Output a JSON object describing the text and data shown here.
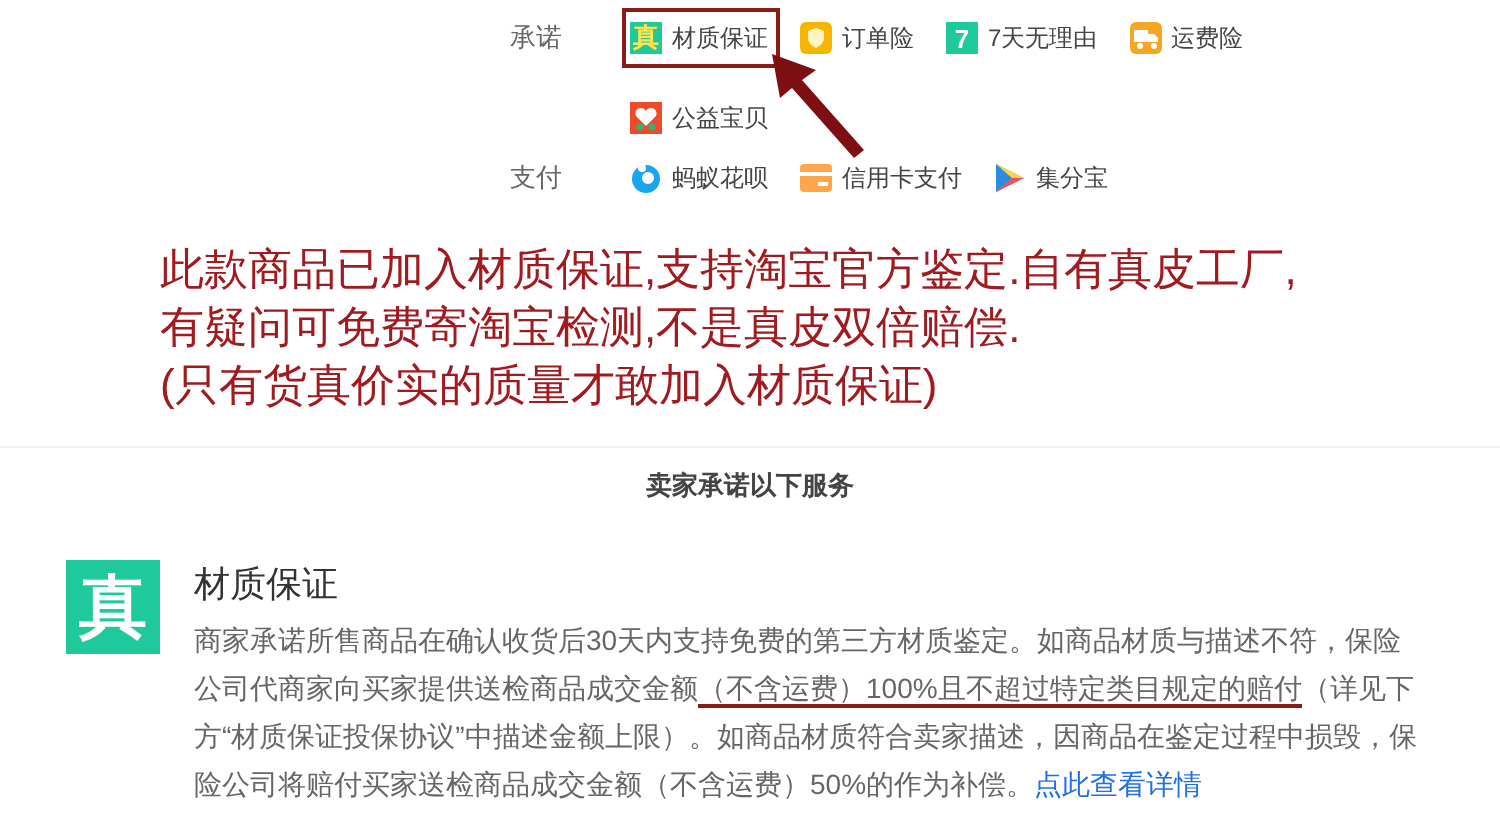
{
  "service_rows": [
    {
      "label": "承诺",
      "items": [
        {
          "kind": "zhen",
          "glyph": "真",
          "text": "材质保证",
          "selected": true
        },
        {
          "kind": "shield",
          "text": "订单险",
          "selected": false
        },
        {
          "kind": "seven",
          "glyph": "7",
          "text": "7天无理由",
          "selected": false
        },
        {
          "kind": "truck",
          "text": "运费险",
          "selected": false
        },
        {
          "kind": "heart",
          "text": "公益宝贝",
          "selected": false
        }
      ]
    },
    {
      "label": "支付",
      "items": [
        {
          "kind": "huabei",
          "text": "蚂蚁花呗",
          "selected": false
        },
        {
          "kind": "card",
          "text": "信用卡支付",
          "selected": false
        },
        {
          "kind": "play",
          "text": "集分宝",
          "selected": false
        }
      ]
    }
  ],
  "annotation": {
    "lines": [
      "此款商品已加入材质保证,支持淘宝官方鉴定.自有真皮工厂,",
      "有疑问可免费寄淘宝检测,不是真皮双倍赔偿.",
      "(只有货真价实的质量才敢加入材质保证)"
    ]
  },
  "section_title": "卖家承诺以下服务",
  "service": {
    "badge": "真",
    "title": "材质保证",
    "description": [
      {
        "text": "商家承诺所售商品在确认收货后30天内支持免费的第三方材质鉴定。如商品材质与描述不符，保险公司代商家向买家提供送检商品成交金额",
        "underlined": false
      },
      {
        "text": "（不含运费）100%且不超过特定类目规定的赔付",
        "underlined": true
      },
      {
        "text": "（详见下方“材质保证投保协议”中描述金额上限）。如商品材质符合卖家描述，因商品在鉴定过程中损毁，保险公司将赔付买家送检商品成交金额（不含运费）50%的作为补偿。",
        "underlined": false
      }
    ],
    "link": "点此查看详情"
  }
}
